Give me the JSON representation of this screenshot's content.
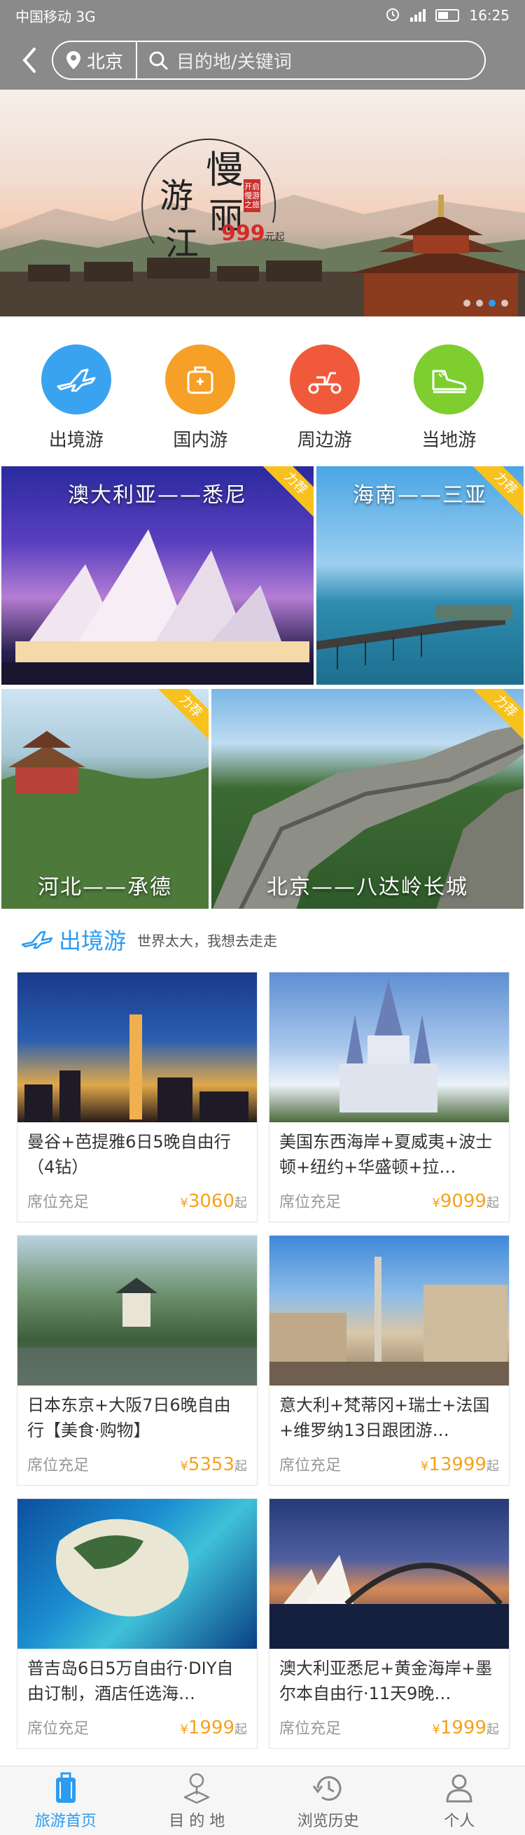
{
  "status_bar": {
    "carrier": "中国移动 3G",
    "network": "3G",
    "time": "16:25"
  },
  "header": {
    "city": "北京",
    "search_placeholder": "目的地/关键词"
  },
  "banner": {
    "title_chars": [
      "慢",
      "游",
      "丽",
      "江"
    ],
    "stamp": "开启慢游之旅",
    "price": "999",
    "price_suffix": "元起"
  },
  "categories": [
    {
      "label": "出境游",
      "icon": "airplane-icon",
      "color": "#3aa3f0"
    },
    {
      "label": "国内游",
      "icon": "suitcase-icon",
      "color": "#f6a028"
    },
    {
      "label": "周边游",
      "icon": "scooter-icon",
      "color": "#f05a3a"
    },
    {
      "label": "当地游",
      "icon": "sneaker-icon",
      "color": "#7dce2e"
    }
  ],
  "destinations": [
    {
      "label": "澳大利亚——悉尼",
      "ribbon": "力荐"
    },
    {
      "label": "海南——三亚",
      "ribbon": "力荐"
    },
    {
      "label": "河北——承德",
      "ribbon": "力荐"
    },
    {
      "label": "北京——八达岭长城",
      "ribbon": "力荐"
    }
  ],
  "section": {
    "title": "出境游",
    "subtitle": "世界太大，我想去走走"
  },
  "products": [
    {
      "title": "曼谷+芭提雅6日5晚自由行（4钻）",
      "seat": "席位充足",
      "currency": "¥",
      "price": "3060",
      "suffix": "起"
    },
    {
      "title": "美国东西海岸+夏威夷+波士顿+纽约+华盛顿+拉…",
      "seat": "席位充足",
      "currency": "¥",
      "price": "9099",
      "suffix": "起"
    },
    {
      "title": "日本东京+大阪7日6晚自由行【美食·购物】",
      "seat": "席位充足",
      "currency": "¥",
      "price": "5353",
      "suffix": "起"
    },
    {
      "title": "意大利+梵蒂冈+瑞士+法国+维罗纳13日跟团游…",
      "seat": "席位充足",
      "currency": "¥",
      "price": "13999",
      "suffix": "起"
    },
    {
      "title": "普吉岛6日5万自由行·DIY自由订制，酒店任选海…",
      "seat": "席位充足",
      "currency": "¥",
      "price": "1999",
      "suffix": "起"
    },
    {
      "title": "澳大利亚悉尼+黄金海岸+墨尔本自由行·11天9晚…",
      "seat": "席位充足",
      "currency": "¥",
      "price": "1999",
      "suffix": "起"
    }
  ],
  "tabbar": [
    {
      "label": "旅游首页",
      "icon": "luggage-icon",
      "active": true
    },
    {
      "label": "目 的 地",
      "icon": "map-pin-icon",
      "active": false
    },
    {
      "label": "浏览历史",
      "icon": "history-icon",
      "active": false
    },
    {
      "label": "个人",
      "icon": "person-icon",
      "active": false
    }
  ]
}
